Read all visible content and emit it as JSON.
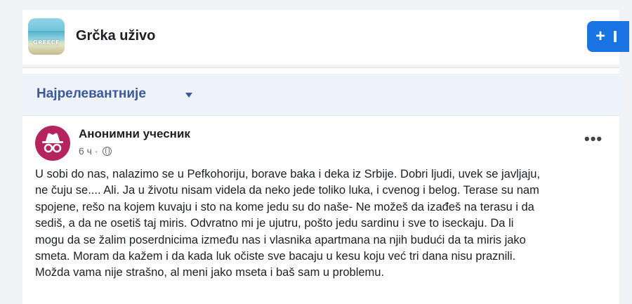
{
  "group": {
    "thumb_text": "GREECE",
    "title": "Grčka uživo",
    "add_label": "+"
  },
  "sort": {
    "label": "Најрелевантније"
  },
  "post": {
    "author": "Анонимни учесник",
    "time": "6 ч",
    "separator": " · ",
    "more": "•••",
    "lines": [
      "U sobi do nas, nalazimo se u Pefkohoriju, borave baka i deka iz Srbije. Dobri ljudi, uvek se javljaju,",
      "ne čuju se.... Ali. Ja u životu nisam videla da neko jede toliko luka, i cvenog i belog. Terase su nam",
      "spojene, rešo na kojem kuvaju i sto na kome jedu su do naše- Ne možeš da izađeš na terasu i da",
      "sediš, a da ne osetiš taj miris. Odvratno mi je ujutru, pošto jedu sardinu i sve to iseckaju. Da li",
      "mogu da se žalim poserdnicima između nas i vlasnika apartmana na njih budući da ta miris jako",
      "smeta. Moram da kažem i da kada luk očiste sve bacaju u kesu koju već tri dana nisu praznili.",
      "Možda vama nije strašno, al meni jako mseta i baš sam u problemu."
    ]
  },
  "colors": {
    "accent": "#1b74e4",
    "sort_text": "#3b5998",
    "avatar_bg": "#b5245f"
  },
  "icons": [
    "group-thumbnail",
    "incognito-avatar-icon",
    "globe-icon",
    "more-options-icon",
    "dropdown-caret-icon"
  ]
}
